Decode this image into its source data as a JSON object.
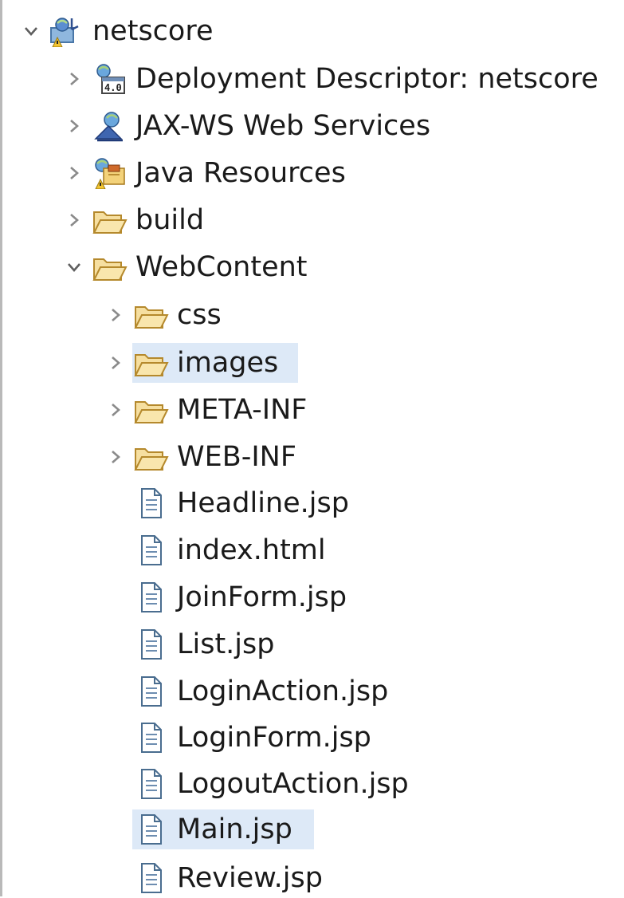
{
  "tree": {
    "root": {
      "label": "netscore",
      "icon": "web-project-icon",
      "expanded": true
    },
    "children": [
      {
        "id": "deployment",
        "label": "Deployment Descriptor: netscore",
        "icon": "deployment-descriptor-icon",
        "expanded": false
      },
      {
        "id": "jaxws",
        "label": "JAX-WS Web Services",
        "icon": "web-services-icon",
        "expanded": false
      },
      {
        "id": "javares",
        "label": "Java Resources",
        "icon": "java-resources-icon",
        "expanded": false
      },
      {
        "id": "build",
        "label": "build",
        "icon": "folder-icon",
        "expanded": false
      },
      {
        "id": "webcontent",
        "label": "WebContent",
        "icon": "folder-icon",
        "expanded": true
      }
    ],
    "webcontent_children": [
      {
        "label": "css",
        "type": "folder",
        "expanded": false
      },
      {
        "label": "images",
        "type": "folder",
        "expanded": false,
        "highlighted": true
      },
      {
        "label": "META-INF",
        "type": "folder",
        "expanded": false
      },
      {
        "label": "WEB-INF",
        "type": "folder",
        "expanded": false
      },
      {
        "label": "Headline.jsp",
        "type": "file"
      },
      {
        "label": "index.html",
        "type": "file"
      },
      {
        "label": "JoinForm.jsp",
        "type": "file"
      },
      {
        "label": "List.jsp",
        "type": "file"
      },
      {
        "label": "LoginAction.jsp",
        "type": "file"
      },
      {
        "label": "LoginForm.jsp",
        "type": "file"
      },
      {
        "label": "LogoutAction.jsp",
        "type": "file"
      },
      {
        "label": "Main.jsp",
        "type": "file",
        "selected": true
      },
      {
        "label": "Review.jsp",
        "type": "file"
      }
    ]
  },
  "colors": {
    "selection": "#dde9f7",
    "folder_fill": "#f5d68a",
    "folder_stroke": "#b5892c",
    "chevron": "#7a7a7a"
  }
}
